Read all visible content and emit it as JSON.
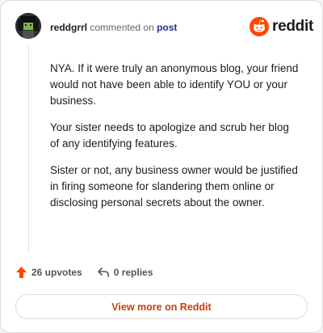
{
  "comment": {
    "username": "reddgrrl",
    "action_text": "commented on",
    "post_link": "post",
    "paragraphs": [
      "NYA. If it were truly an anonymous blog, your friend would not have been able to identify YOU or your business.",
      "Your sister needs to apologize and scrub her blog of any identifying features.",
      "Sister or not, any business owner would be justified in firing someone for slandering them online or disclosing personal secrets about the owner."
    ]
  },
  "brand": {
    "logo_text": "reddit",
    "accent_color": "#ff4500"
  },
  "actions": {
    "upvotes_label": "26 upvotes",
    "replies_label": "0 replies"
  },
  "footer": {
    "view_more_label": "View more on Reddit"
  },
  "icons": {
    "avatar": "user-avatar",
    "logo": "reddit-logo-icon",
    "upvote": "upvote-arrow-icon",
    "reply": "reply-arrow-icon"
  }
}
